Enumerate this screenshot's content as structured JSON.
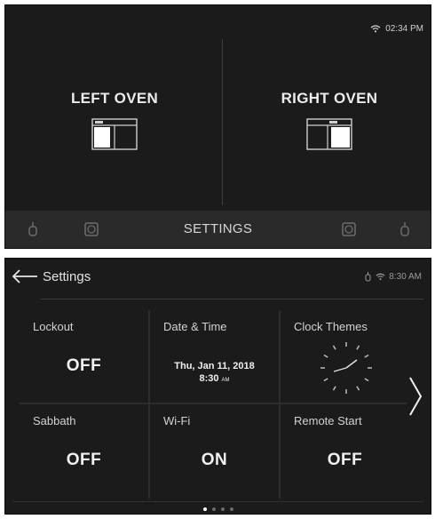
{
  "home_screen": {
    "status": {
      "time": "02:34 PM"
    },
    "left_oven": {
      "label": "LEFT OVEN"
    },
    "right_oven": {
      "label": "RIGHT OVEN"
    },
    "bottom_bar": {
      "settings_label": "SETTINGS"
    }
  },
  "settings_screen": {
    "header": {
      "title": "Settings",
      "time": "8:30 AM"
    },
    "tiles": [
      {
        "label": "Lockout",
        "value": "OFF"
      },
      {
        "label": "Date & Time",
        "date": "Thu, Jan 11, 2018",
        "time": "8:30",
        "ampm": "AM"
      },
      {
        "label": "Clock Themes"
      },
      {
        "label": "Sabbath",
        "value": "OFF"
      },
      {
        "label": "Wi-Fi",
        "value": "ON"
      },
      {
        "label": "Remote Start",
        "value": "OFF"
      }
    ],
    "pager": {
      "pages": 4,
      "current": 1
    }
  },
  "colors": {
    "background": "#1b1b1b",
    "bar": "#2a2a2a",
    "text": "#e6e6e6"
  },
  "icons": [
    "wifi-icon",
    "oven-left-icon",
    "oven-right-icon",
    "probe-icon",
    "timer-icon",
    "back-arrow-icon",
    "chevron-right-icon",
    "clock-face-icon"
  ]
}
